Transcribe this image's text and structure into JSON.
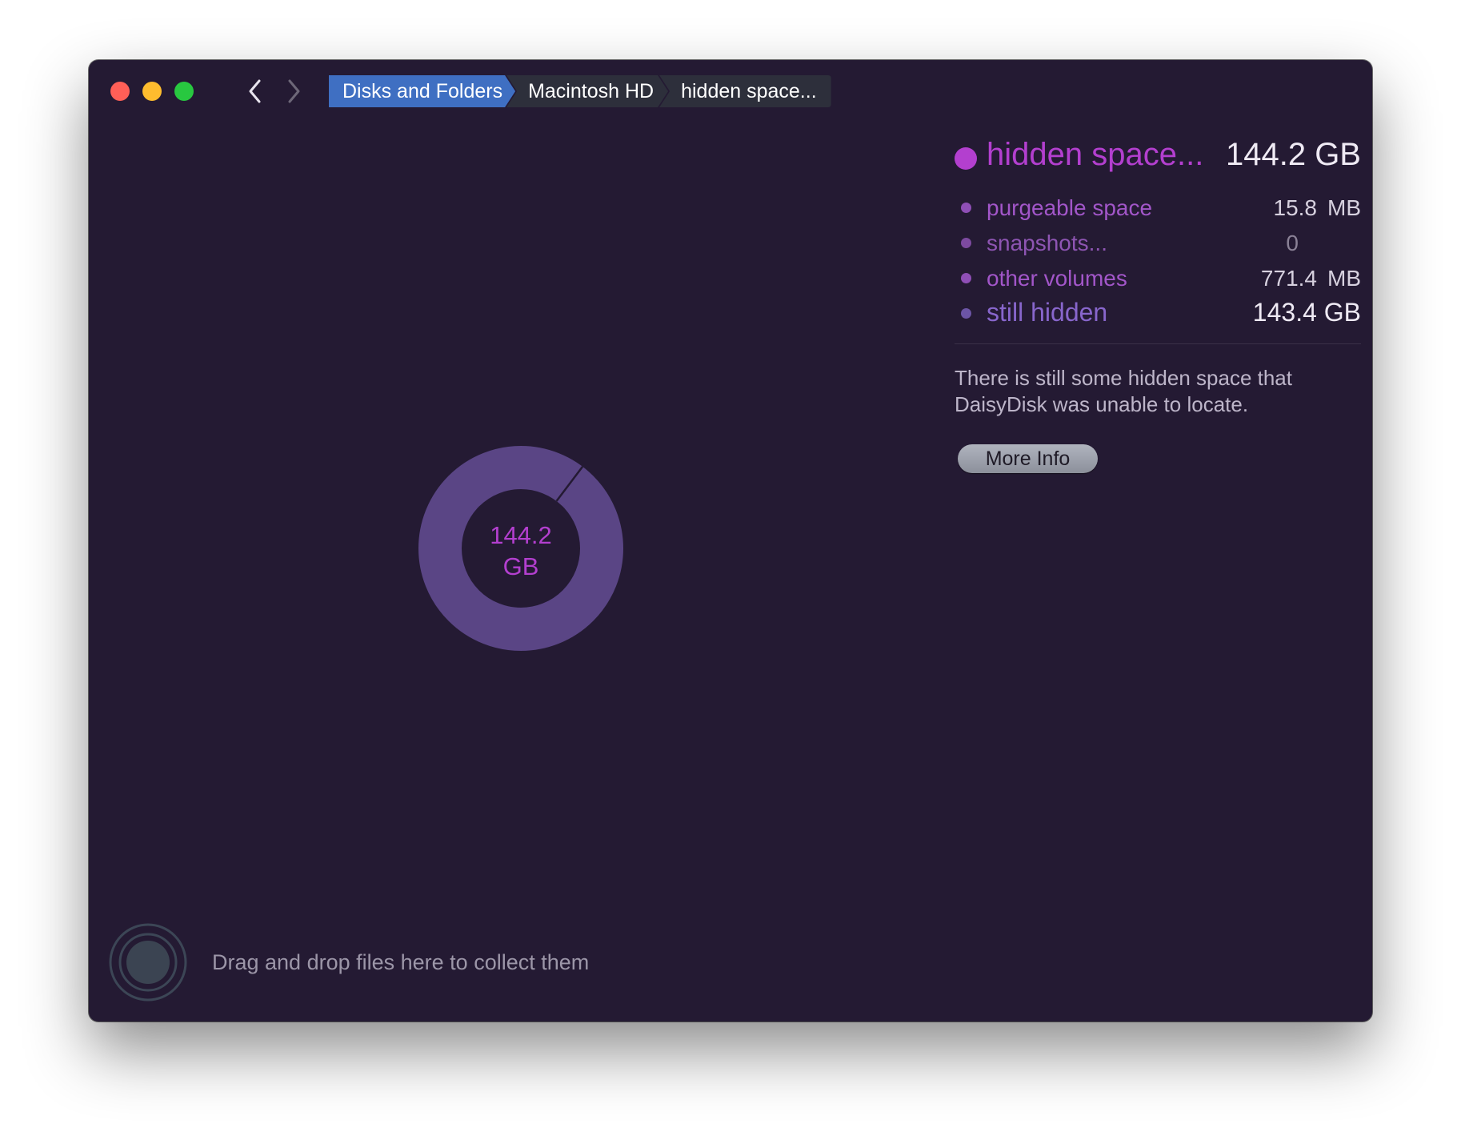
{
  "titlebar": {
    "breadcrumb": [
      "Disks and Folders",
      "Macintosh HD",
      "hidden space..."
    ]
  },
  "chart_data": {
    "type": "pie",
    "center_label_value": "144.2",
    "center_label_unit": "GB",
    "slices": [
      {
        "name": "still hidden",
        "value": 143.4,
        "unit": "GB"
      },
      {
        "name": "other volumes",
        "value": 0.7714,
        "unit": "GB"
      },
      {
        "name": "purgeable space",
        "value": 0.0158,
        "unit": "GB"
      },
      {
        "name": "snapshots...",
        "value": 0,
        "unit": "GB"
      }
    ]
  },
  "info": {
    "name": "hidden space...",
    "size": "144.2 GB",
    "items": [
      {
        "label": "purgeable space",
        "value": "15.8",
        "unit": "MB"
      },
      {
        "label": "snapshots...",
        "value": "0",
        "unit": ""
      },
      {
        "label": "other volumes",
        "value": "771.4",
        "unit": "MB"
      },
      {
        "label": "still hidden",
        "value": "143.4 GB"
      }
    ],
    "description": "There is still some hidden space that DaisyDisk was unable to locate.",
    "button_label": "More Info"
  },
  "footer": {
    "drop_hint": "Drag and drop files here to collect them"
  },
  "colors": {
    "window_bg": "#241a33",
    "accent_magenta": "#b33fcf",
    "label_purple": "#a256c9",
    "still_hidden_purple": "#8866cc",
    "donut_ring": "#5a4585",
    "breadcrumb_active": "#3f6fc2"
  },
  "icons": {
    "back": "chevron-left-icon",
    "forward": "chevron-right-icon",
    "collector": "collector-target-icon"
  }
}
